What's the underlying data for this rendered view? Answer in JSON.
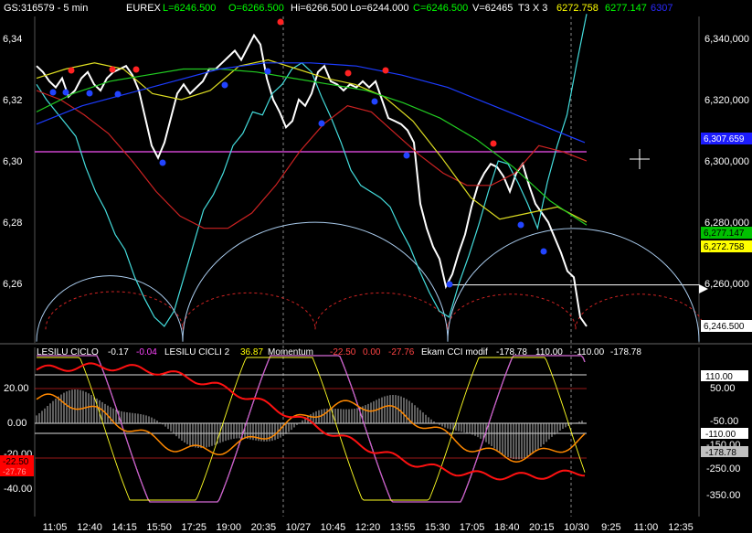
{
  "header": {
    "symbol": "GS:316579 - 5 min",
    "exchange": "EUREX",
    "last": "L=6246.500",
    "open": "O=6266.500",
    "high": "Hi=6266.500",
    "low": "Lo=6244.000",
    "close": "C=6246.500",
    "volume": "V=62465",
    "multiplier": "T3 X 3",
    "val1": "6272.758",
    "val2": "6277.147",
    "val3": "6307",
    "colors": {
      "text": "#ffffff",
      "green": "#00ff00",
      "yellow": "#ffff00",
      "blue": "#2a2aff"
    }
  },
  "lower_header": {
    "l1": "LESILU CICLO",
    "v1": "-0.17",
    "v2": "-0.04",
    "l2": "LESILU CICLI 2",
    "v3": "36.87",
    "l3": "Momentum",
    "v4": "-22.50",
    "v5": "0.00",
    "v6": "-27.76",
    "l4": "Ekam CCI modif",
    "v7": "-178.78",
    "v8": "110.00",
    "v9": "-110.00",
    "v10": "-178.78"
  },
  "price_axis": {
    "left_ticks": [
      "6,34",
      "6,32",
      "6,30",
      "6,28",
      "6,26"
    ],
    "right_ticks": [
      "6,340,000",
      "6,320,000",
      "6,300,000",
      "6,280,000",
      "6,260,000"
    ],
    "badges": [
      {
        "text": "6,307.659",
        "bg": "#1c1cff",
        "fg": "#ffffff"
      },
      {
        "text": "6,277.147",
        "bg": "#00c000",
        "fg": "#000000"
      },
      {
        "text": "6,272.758",
        "bg": "#ffff00",
        "fg": "#000000"
      },
      {
        "text": "6,246.500",
        "bg": "#ffffff",
        "fg": "#000000"
      }
    ]
  },
  "lower_axis": {
    "left_ticks": [
      "20.00",
      "0.00",
      "-20.00",
      "-40.00"
    ],
    "left_badges": [
      {
        "text": "-22.50",
        "bg": "#ff0000",
        "fg": "#000000"
      },
      {
        "text": "-27.76",
        "bg": "#ff0000",
        "fg": "#ff9999"
      }
    ],
    "right_ticks": [
      "50.00",
      "-50.00",
      "-150.00",
      "-250.00",
      "-350.00"
    ],
    "right_badges": [
      {
        "text": "110.00",
        "bg": "#ffffff",
        "fg": "#000000"
      },
      {
        "text": "-110.00",
        "bg": "#ffffff",
        "fg": "#000000"
      },
      {
        "text": "-178.78",
        "bg": "#c0c0c0",
        "fg": "#000000"
      }
    ]
  },
  "time_axis": [
    "11:05",
    "12:40",
    "14:15",
    "15:50",
    "17:25",
    "19:00",
    "20:35",
    "10/27",
    "10:45",
    "12:20",
    "13:55",
    "15:30",
    "17:05",
    "18:40",
    "20:15",
    "10/30",
    "9:25",
    "11:00",
    "12:35"
  ],
  "chart_data": {
    "type": "line",
    "title": "GS:316579 - 5 min",
    "ylim_price": [
      6240,
      6345
    ],
    "ylim_lower_left": [
      -50,
      38
    ],
    "series": [
      {
        "name": "price",
        "color": "#ffffff",
        "values": [
          6331,
          6329,
          6326,
          6324,
          6327,
          6321,
          6323,
          6327,
          6329,
          6325,
          6323,
          6327,
          6329,
          6330,
          6331,
          6328,
          6323,
          6314,
          6305,
          6301,
          6306,
          6314,
          6322,
          6325,
          6322,
          6324,
          6326,
          6330,
          6330,
          6332,
          6334,
          6336,
          6333,
          6337,
          6341,
          6338,
          6327,
          6320,
          6316,
          6311,
          6313,
          6320,
          6318,
          6322,
          6329,
          6331,
          6326,
          6325,
          6323,
          6325,
          6324,
          6326,
          6324,
          6326,
          6320,
          6314,
          6313,
          6312,
          6310,
          6306,
          6286,
          6278,
          6272,
          6268,
          6259,
          6263,
          6270,
          6276,
          6285,
          6292,
          6296,
          6299,
          6298,
          6295,
          6290,
          6296,
          6299,
          6292,
          6286,
          6283,
          6280,
          6275,
          6270,
          6264,
          6262,
          6249,
          6246
        ]
      },
      {
        "name": "cyan oscillator",
        "color": "#44dddd",
        "values": [
          6325,
          6320,
          6316,
          6312,
          6308,
          6298,
          6290,
          6284,
          6276,
          6271,
          6262,
          6255,
          6249,
          6246,
          6251,
          6262,
          6273,
          6284,
          6289,
          6296,
          6305,
          6309,
          6316,
          6315,
          6322,
          6325,
          6330,
          6332,
          6329,
          6321,
          6314,
          6306,
          6297,
          6292,
          6290,
          6288,
          6285,
          6278,
          6272,
          6264,
          6257,
          6251,
          6249,
          6260,
          6269,
          6279,
          6290,
          6300,
          6299,
          6293,
          6286,
          6278,
          6293,
          6305,
          6315,
          6332,
          6348
        ]
      },
      {
        "name": "red smooth",
        "color": "#cc2222",
        "values": [
          6323,
          6320,
          6315,
          6309,
          6300,
          6290,
          6282,
          6278,
          6278,
          6283,
          6292,
          6303,
          6312,
          6318,
          6316,
          6309,
          6302,
          6296,
          6292,
          6292,
          6296,
          6305,
          6303,
          6300
        ]
      },
      {
        "name": "yellow smooth",
        "color": "#dddd22",
        "values": [
          6327,
          6330,
          6332,
          6330,
          6322,
          6320,
          6323,
          6331,
          6333,
          6330,
          6327,
          6325,
          6321,
          6313,
          6301,
          6288,
          6281,
          6283,
          6285,
          6280
        ]
      },
      {
        "name": "green smooth",
        "color": "#22cc22",
        "values": [
          6316,
          6322,
          6326,
          6328,
          6330,
          6330,
          6329,
          6327,
          6325,
          6323,
          6319,
          6314,
          6307,
          6298,
          6287,
          6279
        ]
      },
      {
        "name": "blue smooth",
        "color": "#1c3cff",
        "values": [
          6312,
          6318,
          6322,
          6326,
          6330,
          6332,
          6332,
          6331,
          6328,
          6324,
          6318,
          6312,
          6306
        ]
      }
    ]
  }
}
